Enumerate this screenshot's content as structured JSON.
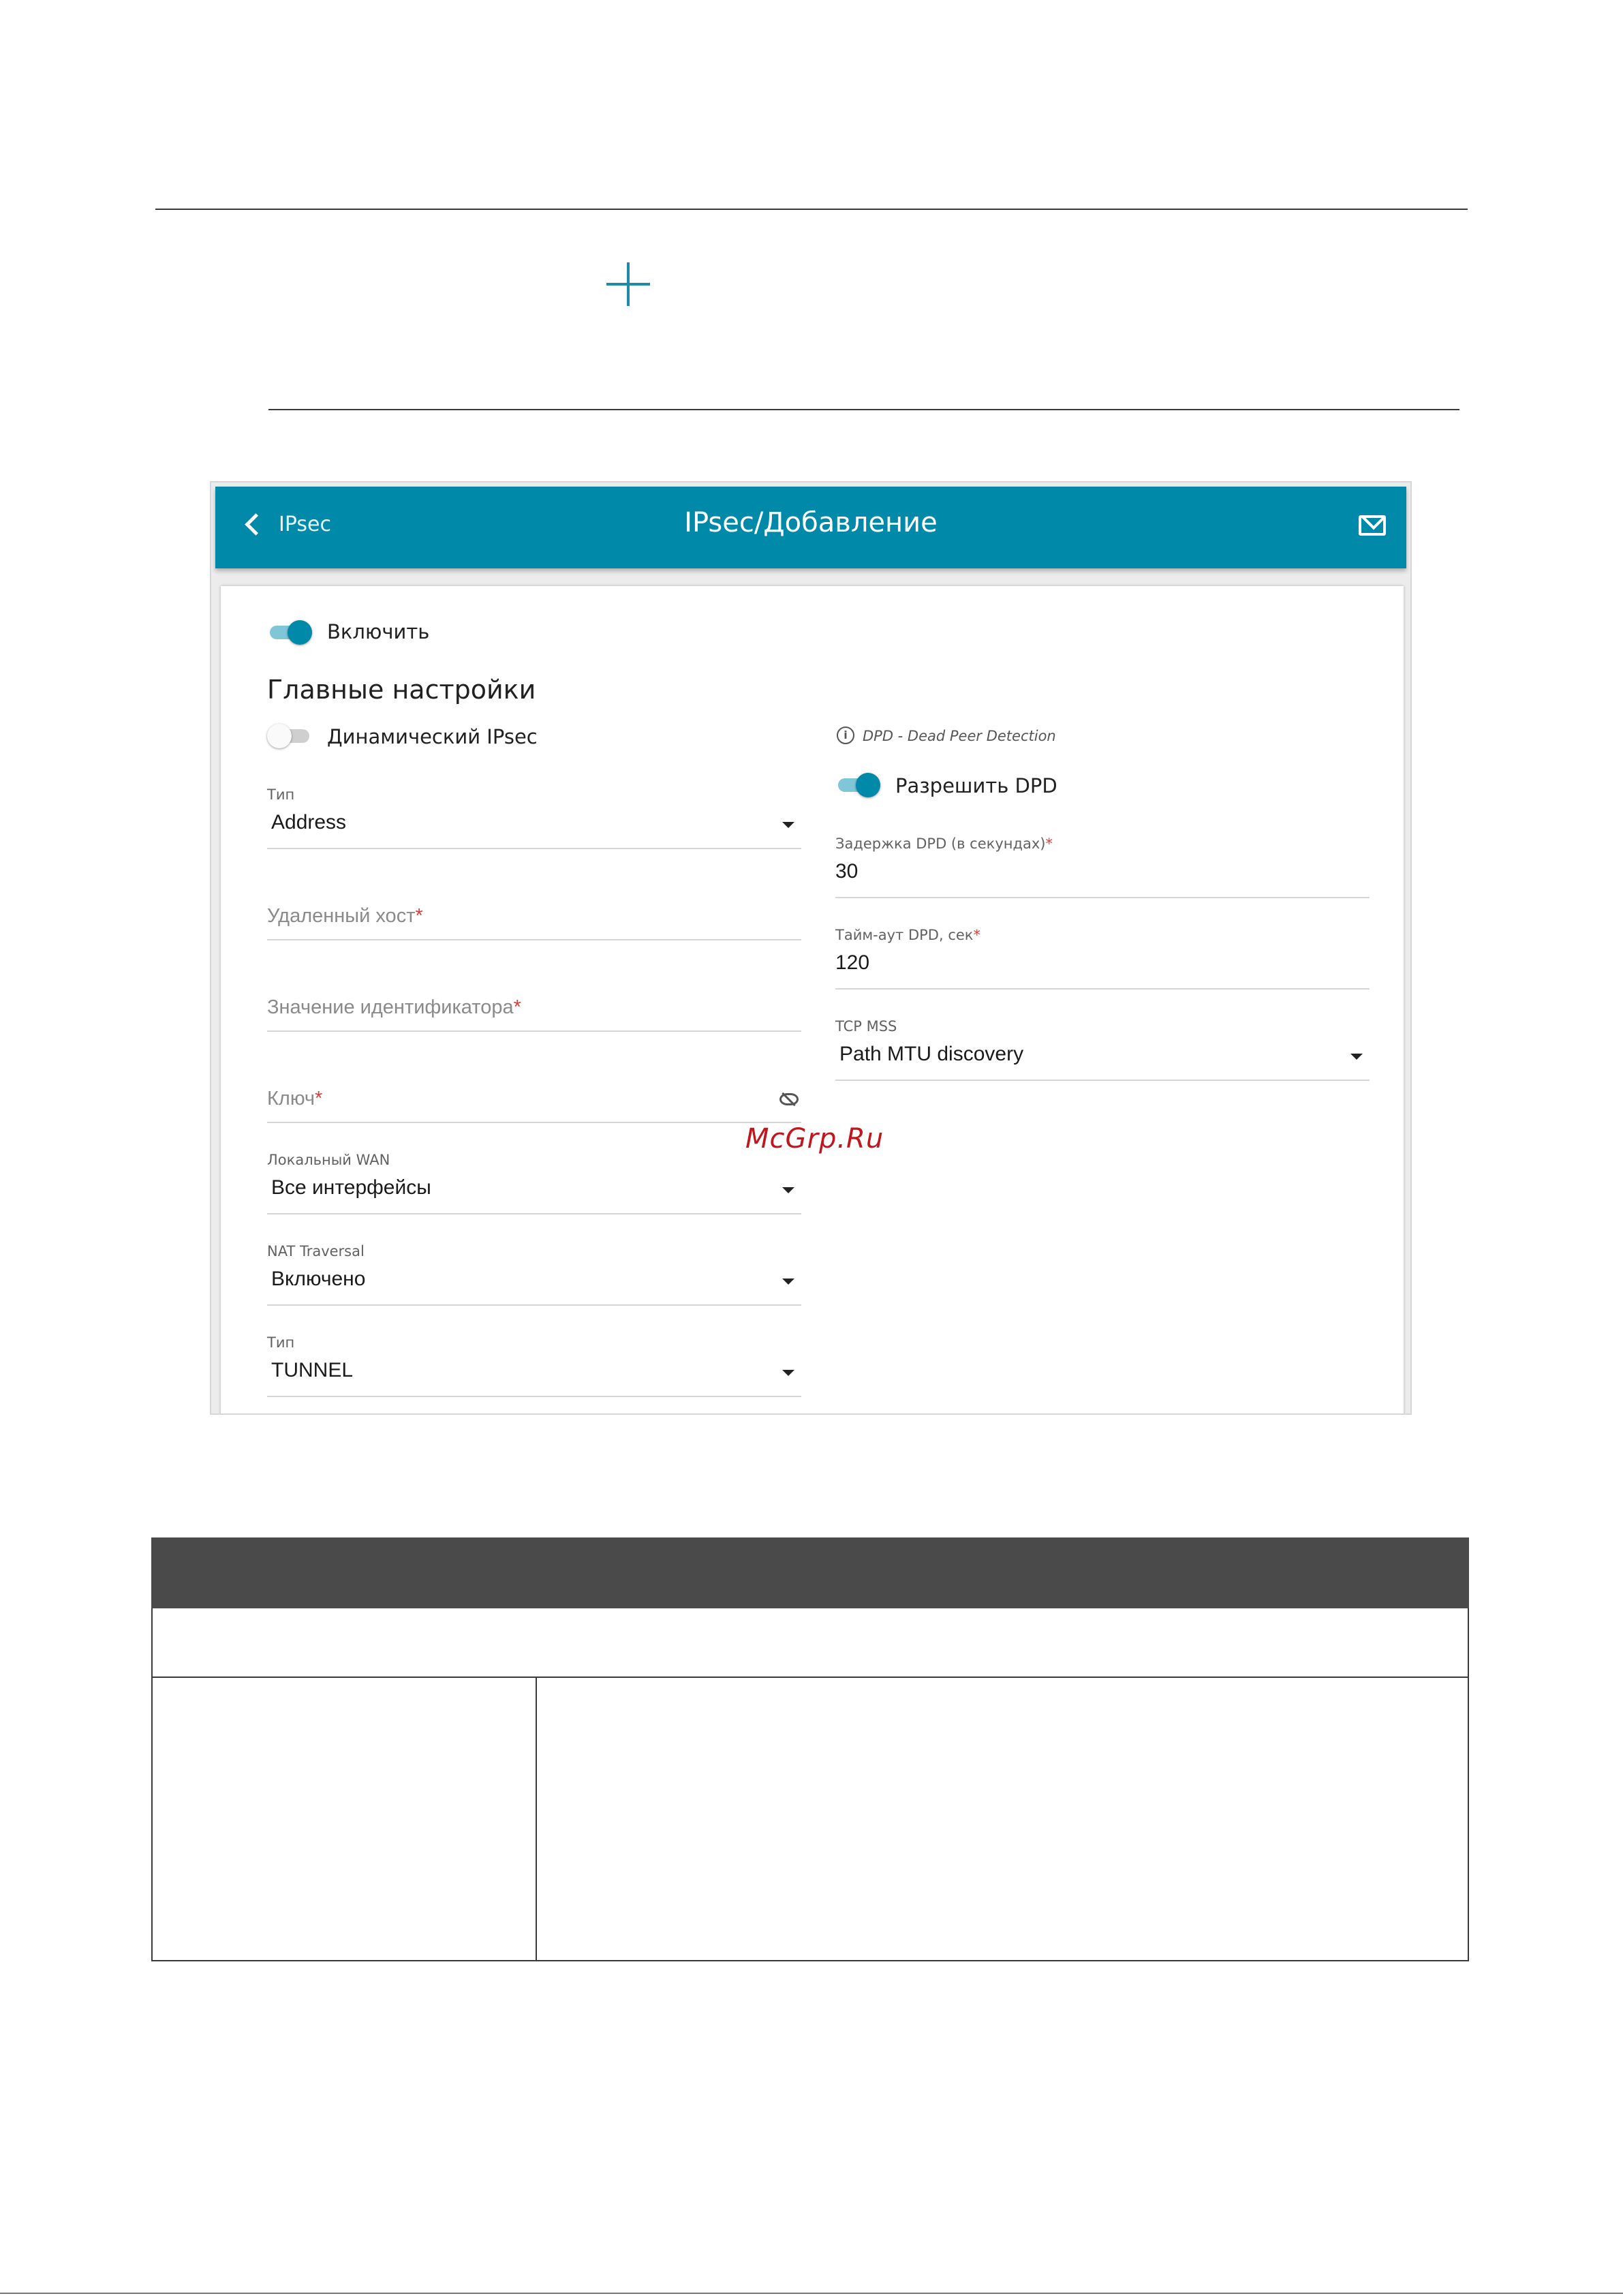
{
  "appbar": {
    "back_label": "IPsec",
    "title": "IPsec/Добавление"
  },
  "form": {
    "enable_label": "Включить",
    "enable_on": true,
    "section_title": "Главные настройки",
    "dynamic_label": "Динамический IPsec",
    "dynamic_on": false,
    "type1": {
      "label": "Тип",
      "value": "Address"
    },
    "remote_host": {
      "placeholder": "Удаленный хост",
      "required": "*"
    },
    "identifier": {
      "placeholder": "Значение идентификатора",
      "required": "*"
    },
    "key": {
      "placeholder": "Ключ",
      "required": "*"
    },
    "local_wan": {
      "label": "Локальный WAN",
      "value": "Все интерфейсы"
    },
    "nat_traversal": {
      "label": "NAT Traversal",
      "value": "Включено"
    },
    "type2": {
      "label": "Тип",
      "value": "TUNNEL"
    },
    "dpd_info": "DPD - Dead Peer Detection",
    "dpd_enable_label": "Разрешить DPD",
    "dpd_enable_on": true,
    "dpd_delay": {
      "label": "Задержка DPD (в секундах)",
      "required": "*",
      "value": "30"
    },
    "dpd_timeout": {
      "label": "Тайм-аут DPD, сек",
      "required": "*",
      "value": "120"
    },
    "tcp_mss": {
      "label": "TCP MSS",
      "value": "Path MTU discovery"
    }
  },
  "watermark": "McGrp.Ru",
  "colors": {
    "accent": "#0089a8",
    "required": "#e53935",
    "table_header": "#4a4a4a"
  }
}
